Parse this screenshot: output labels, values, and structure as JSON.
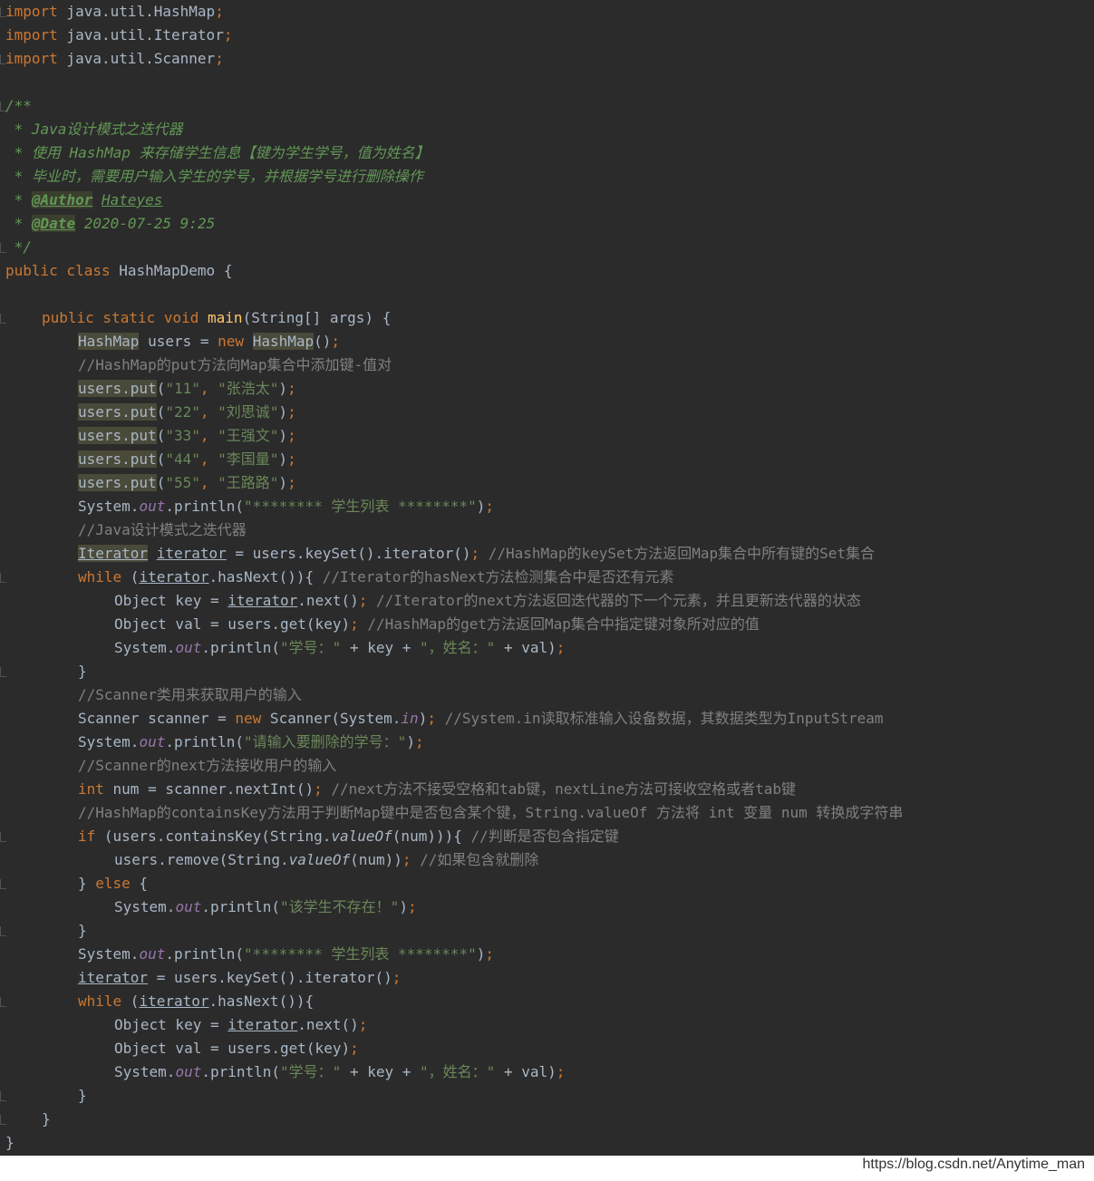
{
  "code": {
    "l01_kw": "import",
    "l01_rest": " java.util.HashMap",
    "l02_rest": " java.util.Iterator",
    "l03_rest": " java.util.Scanner",
    "l05": "/**",
    "l06": " * Java设计模式之迭代器",
    "l07": " * 使用 HashMap 来存储学生信息【键为学生学号，值为姓名】",
    "l08": " * 毕业时，需要用户输入学生的学号，并根据学号进行删除操作",
    "l09_star": " * ",
    "l09_tag": "@Author",
    "l09_val": "Hateyes",
    "l10_tag": "@Date",
    "l10_val": " 2020-07-25 9:25",
    "l11": " */",
    "l12_kw": "public class",
    "l12_rest": " HashMapDemo {",
    "l14_kw": "public static void",
    "l14_fn": "main",
    "l14_rest": "(String[] args) {",
    "l15_type": "HashMap",
    "l15_mid": " users = ",
    "l15_new": "new",
    "l15_type2": "HashMap",
    "l15_end": "()",
    "l16": "//HashMap的put方法向Map集合中添加键-值对",
    "users_put": "users.put",
    "puts": [
      {
        "k": "\"11\"",
        "v": "\"张浩太\""
      },
      {
        "k": "\"22\"",
        "v": "\"刘思诚\""
      },
      {
        "k": "\"33\"",
        "v": "\"王强文\""
      },
      {
        "k": "\"44\"",
        "v": "\"李国量\""
      },
      {
        "k": "\"55\"",
        "v": "\"王路路\""
      }
    ],
    "system": "System.",
    "out": "out",
    "println": ".println(",
    "stars_str": "\"******** 学生列表 ********\"",
    "l23": "//Java设计模式之迭代器",
    "l24_type": "Iterator",
    "l24_var": "iterator",
    "l24_rest": " = users.keySet().iterator()",
    "l24_cm": " //HashMap的keySet方法返回Map集合中所有键的Set集合",
    "while_kw": "while",
    "l25_open": " (",
    "l25_var": "iterator",
    "l25_rest": ".hasNext()){",
    "l25_cm": " //Iterator的hasNext方法检测集合中是否还有元素",
    "obj_key": "Object key = ",
    "l26_var": "iterator",
    "l26_rest": ".next()",
    "l26_cm": " //Iterator的next方法返回迭代器的下一个元素，并且更新迭代器的状态",
    "obj_val": "Object val = users.get(key)",
    "l27_cm": " //HashMap的get方法返回Map集合中指定键对象所对应的值",
    "num_str": "\"学号：\"",
    "plus_key": " + key + ",
    "name_str": "\"，姓名：\"",
    "plus_val": " + val)",
    "close_brace": "}",
    "l30": "//Scanner类用来获取用户的输入",
    "l31_a": "Scanner scanner = ",
    "l31_new": "new",
    "l31_b": " Scanner(System.",
    "l31_in": "in",
    "l31_c": ")",
    "l31_cm": " //System.in读取标准输入设备数据，其数据类型为InputStream",
    "l32_str": "\"请输入要删除的学号：\"",
    "l33": "//Scanner的next方法接收用户的输入",
    "l34_kw": "int",
    "l34_rest": " num = scanner.nextInt()",
    "l34_cm": " //next方法不接受空格和tab键，nextLine方法可接收空格或者tab键",
    "l35": "//HashMap的containsKey方法用于判断Map键中是否包含某个键，String.valueOf 方法将 int 变量 num 转换成字符串",
    "l36_kw": "if",
    "l36_a": " (users.containsKey(String.",
    "valueof": "valueOf",
    "l36_b": "(num))){",
    "l36_cm": " //判断是否包含指定键",
    "l37_a": "users.remove(String.",
    "l37_b": "(num))",
    "l37_cm": " //如果包含就删除",
    "l38_a": "} ",
    "l38_kw": "else",
    "l38_b": " {",
    "l39_str": "\"该学生不存在！\"",
    "l42_var": "iterator",
    "l42_rest": " = users.keySet().iterator()",
    "l43_rest": ".hasNext()){",
    "l44_rest": ".next()",
    "semi": ";",
    "comma": ", ",
    "paren_close": ")"
  },
  "watermark": "https://blog.csdn.net/Anytime_man"
}
